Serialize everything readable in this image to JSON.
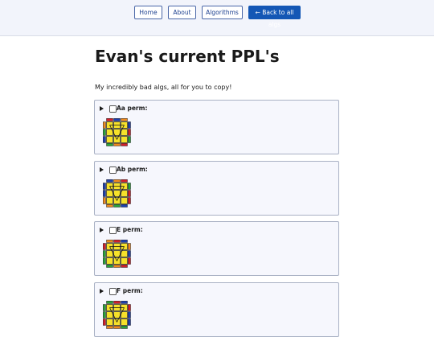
{
  "nav": {
    "home": "Home",
    "about": "About",
    "algorithms": "Algorithms",
    "back": "← Back to all algs"
  },
  "page": {
    "title": "Evan's current PPL's",
    "intro": "My incredibly bad algs, all for you to copy!"
  },
  "colors": {
    "yellow": "#f6e12a",
    "red": "#d3202a",
    "blue": "#1d3fae",
    "green": "#2aa33a",
    "orange": "#ef8a1e",
    "accent": "#1457b5"
  },
  "cases": [
    {
      "title": "Aa perm:",
      "icon": "pll-diagram-aa"
    },
    {
      "title": "Ab perm:",
      "icon": "pll-diagram-ab"
    },
    {
      "title": "E perm:",
      "icon": "pll-diagram-e"
    },
    {
      "title": "F perm:",
      "icon": "pll-diagram-f"
    }
  ]
}
